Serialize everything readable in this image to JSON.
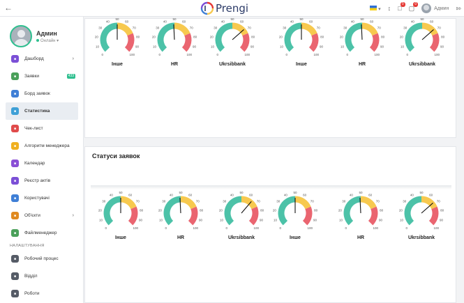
{
  "topbar": {
    "back_icon": "arrow-left-icon",
    "logo_text": "Prengi",
    "user_name": "Админ",
    "bell_badge": "0",
    "chat_badge": "0",
    "lightning_icon": "lightning-icon"
  },
  "sidebar": {
    "user_name": "Админ",
    "user_status": "Онлайн",
    "items": [
      {
        "label": "Дашборд",
        "icon": "dashboard-icon",
        "color": "#7b4fd6",
        "arrow": true
      },
      {
        "label": "Заявки",
        "icon": "requests-icon",
        "color": "#4aa05a",
        "badge": "433"
      },
      {
        "label": "Борд заявок",
        "icon": "board-icon",
        "color": "#3f7fd6"
      },
      {
        "label": "Статистика",
        "icon": "statistics-icon",
        "color": "#3fa0d6",
        "active": true
      },
      {
        "label": "Чек-лист",
        "icon": "checklist-icon",
        "color": "#e04b4b"
      },
      {
        "label": "Алгоритм менеджера",
        "icon": "algorithm-icon",
        "color": "#f0b020"
      },
      {
        "label": "Календар",
        "icon": "calendar-icon",
        "color": "#8a4fd6"
      },
      {
        "label": "Реєстр актів",
        "icon": "acts-registry-icon",
        "color": "#7b4fd6"
      },
      {
        "label": "Користувачі",
        "icon": "users-icon",
        "color": "#3f7fd6"
      },
      {
        "label": "Об'єкти",
        "icon": "objects-icon",
        "color": "#e08a20",
        "arrow": true
      },
      {
        "label": "Файлменеджер",
        "icon": "file-manager-icon",
        "color": "#4aa05a"
      }
    ],
    "settings_label": "НАЛАШТУВАННЯ",
    "settings_items": [
      {
        "label": "Робочий процес",
        "icon": "workflow-icon",
        "color": "#555b66"
      },
      {
        "label": "Відділ",
        "icon": "department-icon",
        "color": "#555b66"
      },
      {
        "label": "Роботи",
        "icon": "works-icon",
        "color": "#555b66"
      }
    ]
  },
  "section2": {
    "title": "Статуси заявок"
  },
  "gauges_top": [
    {
      "label": "Інше",
      "value": 50
    },
    {
      "label": "HR",
      "value": 49
    },
    {
      "label": "Ukrsibbank",
      "value": 68
    },
    {
      "label": "Інше",
      "value": 50
    },
    {
      "label": "HR",
      "value": 49
    },
    {
      "label": "Ukrsibbank",
      "value": 68
    }
  ],
  "gauges_bottom": [
    {
      "label": "Інше",
      "value": 50
    },
    {
      "label": "HR",
      "value": 49
    },
    {
      "label": "Ukrsibbank",
      "value": 65
    },
    {
      "label": "Інше",
      "value": 50
    },
    {
      "label": "HR",
      "value": 49
    },
    {
      "label": "Ukrsibbank",
      "value": 68
    }
  ],
  "gauge_ticks": [
    "0",
    "10",
    "20",
    "30",
    "40",
    "50",
    "60",
    "70",
    "80",
    "90",
    "100"
  ],
  "colors": {
    "green": "#4cc2a8",
    "yellow": "#f7c94f",
    "red": "#ea6570",
    "accent": "#2fbf8f"
  }
}
